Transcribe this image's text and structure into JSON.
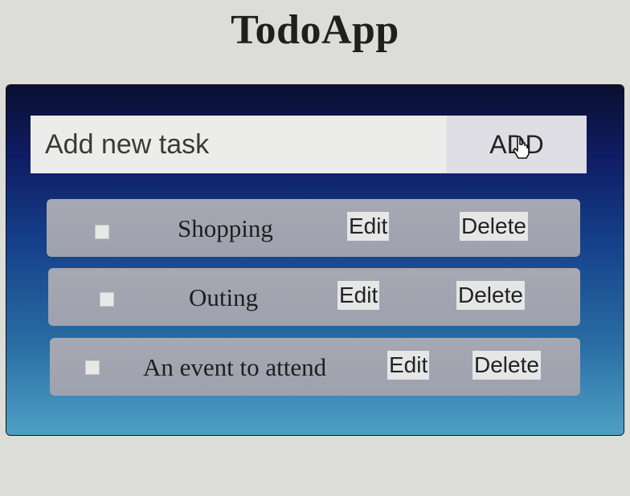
{
  "app": {
    "title": "TodoApp"
  },
  "add_form": {
    "input_placeholder": "Add new task",
    "input_value": "",
    "add_label": "ADD"
  },
  "tasks": [
    {
      "name": "Shopping",
      "checked": false,
      "edit_label": "Edit",
      "delete_label": "Delete"
    },
    {
      "name": "Outing",
      "checked": false,
      "edit_label": "Edit",
      "delete_label": "Delete"
    },
    {
      "name": "An event to attend",
      "checked": false,
      "edit_label": "Edit",
      "delete_label": "Delete"
    }
  ],
  "colors": {
    "panel_top": "#0a1030",
    "panel_bottom": "#4fa0c5",
    "card": "#a6a8b3"
  },
  "icons": {
    "cursor": "hand-pointer-icon"
  }
}
